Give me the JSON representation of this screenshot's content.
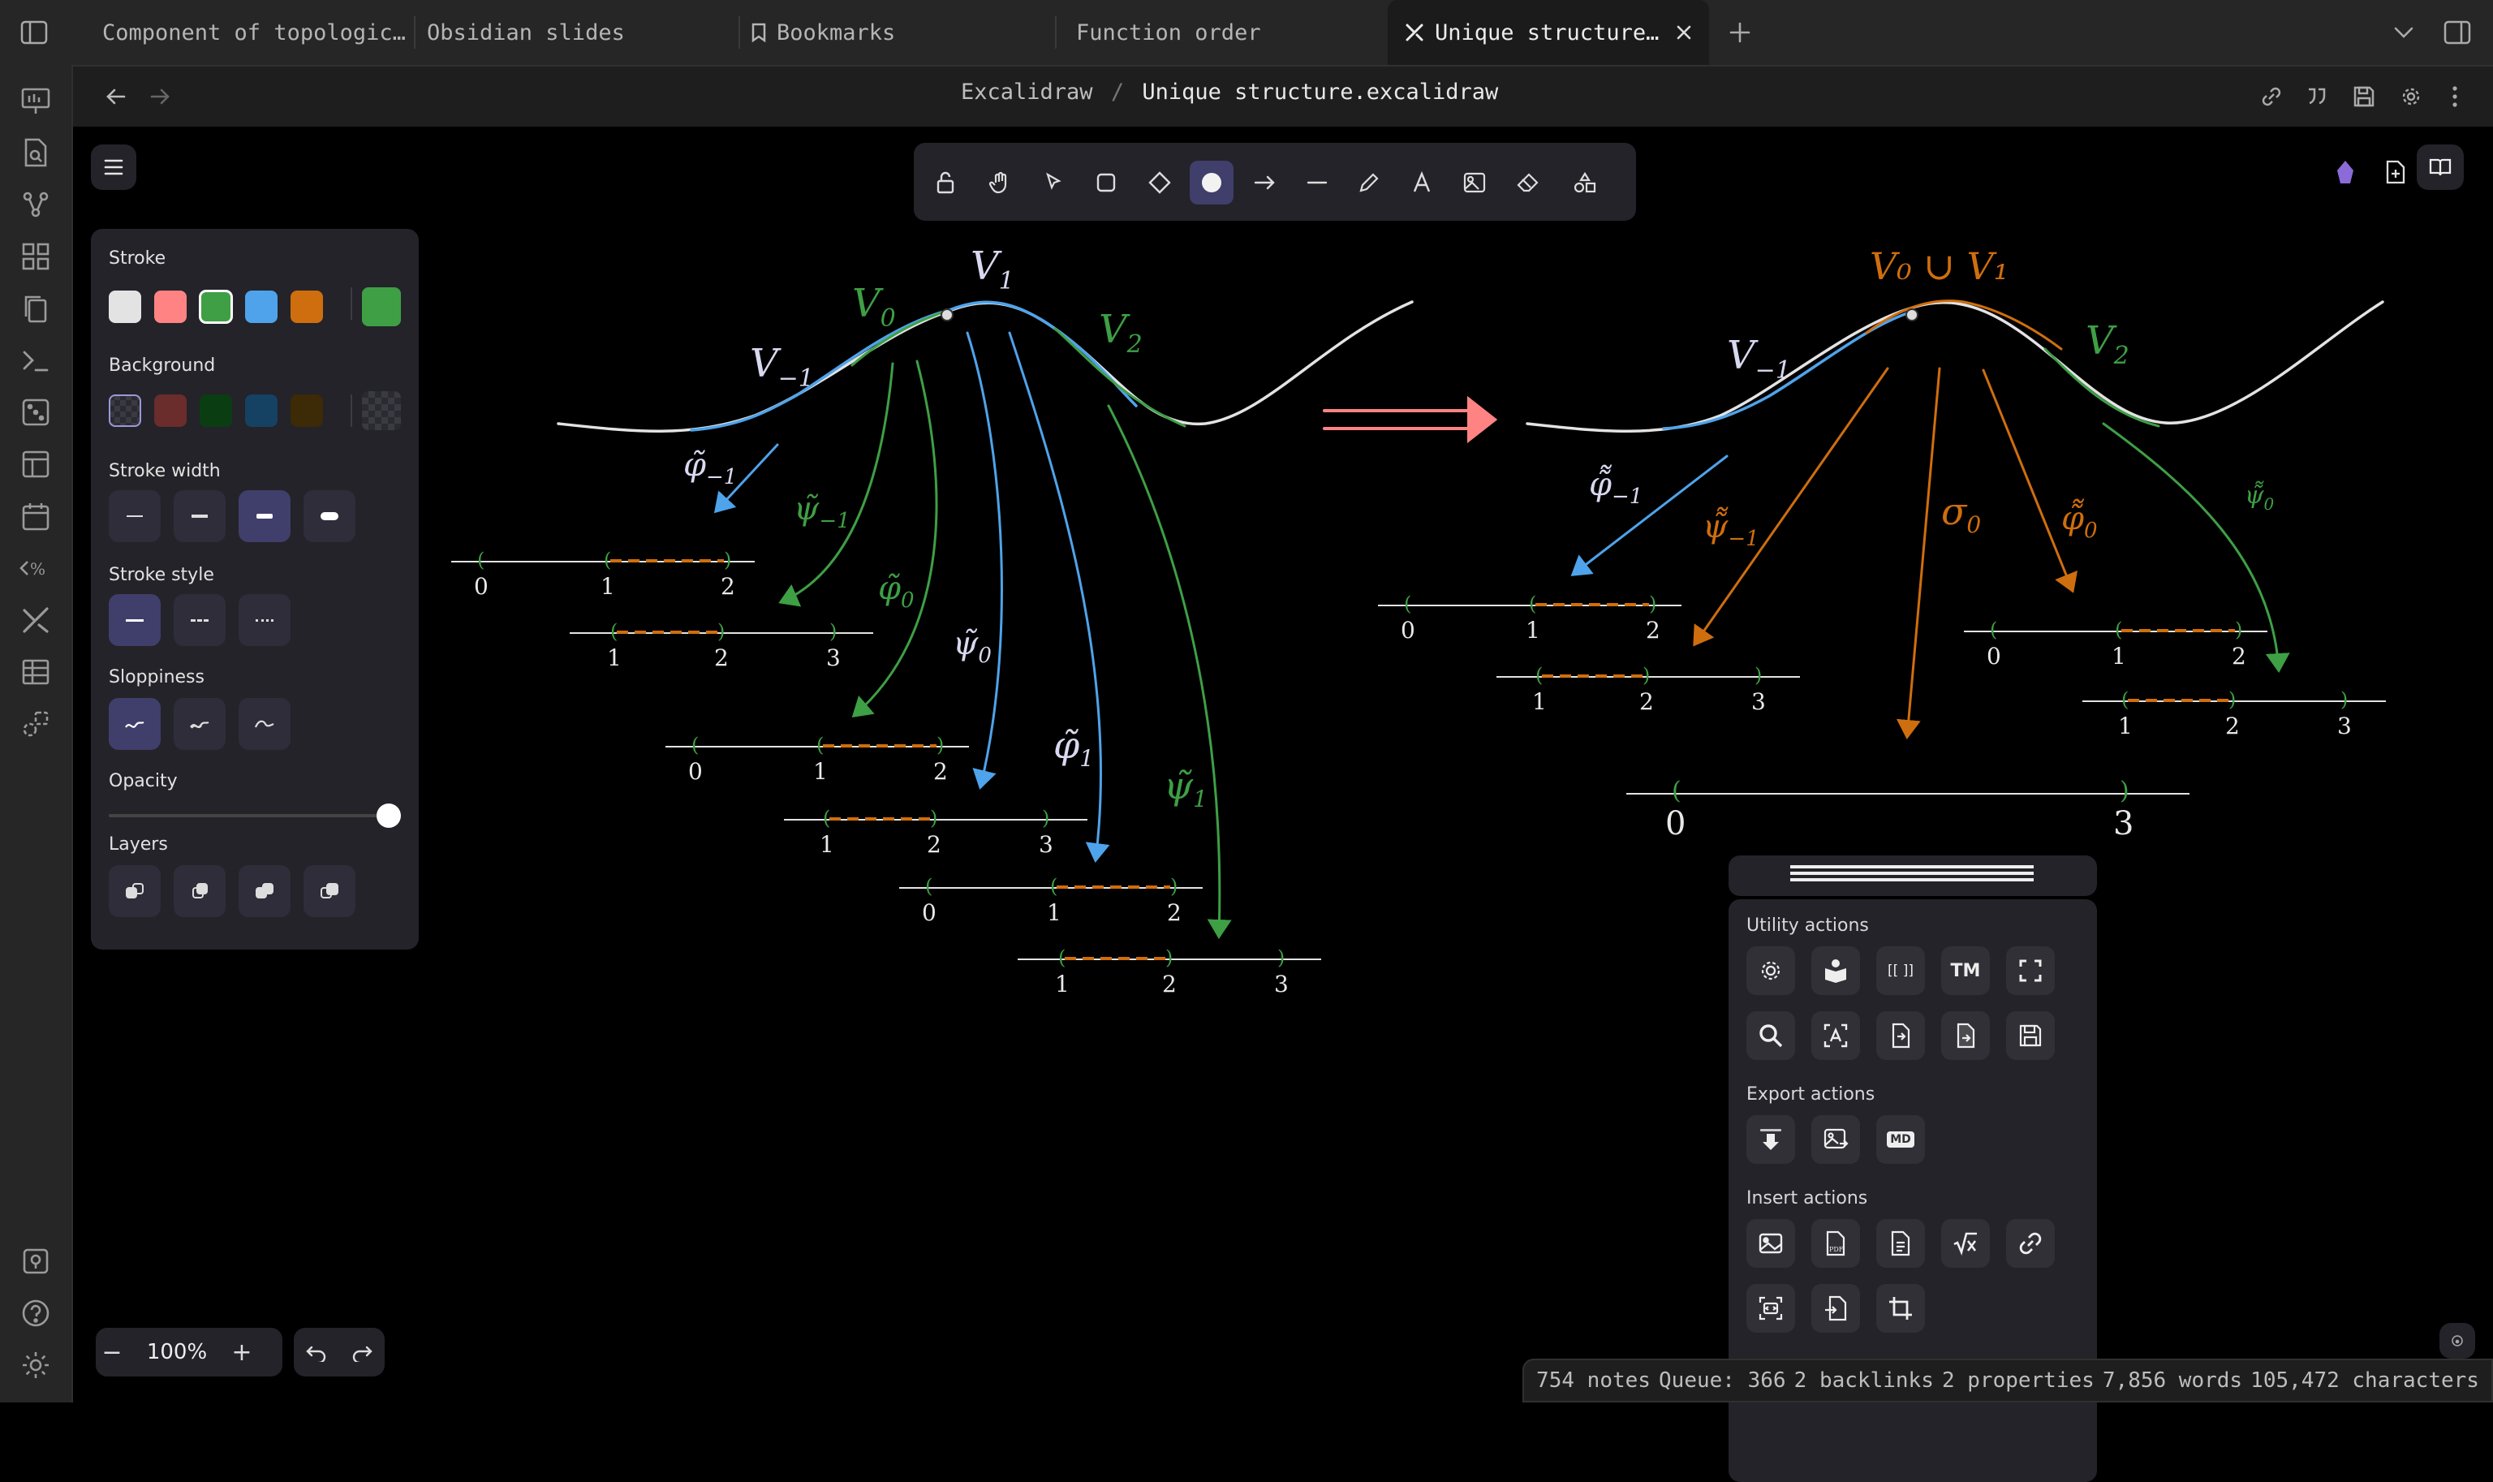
{
  "tabs": [
    {
      "label": "Component of topologic…",
      "active": false
    },
    {
      "label": "Obsidian slides",
      "active": false
    },
    {
      "label": "Bookmarks",
      "active": false
    },
    {
      "label": "Function order",
      "active": false
    },
    {
      "label": "Unique structure…",
      "active": true
    }
  ],
  "breadcrumb": {
    "folder": "Excalidraw",
    "separator": "/",
    "file": "Unique structure.excalidraw"
  },
  "props": {
    "stroke_label": "Stroke",
    "stroke_colors": [
      "#e3e3e3",
      "#ff8383",
      "#3e9f45",
      "#4fa3ea",
      "#cf6e0e"
    ],
    "stroke_current": "#3e9f45",
    "background_label": "Background",
    "background_colors": [
      "#2f2f36",
      "#6b2c2c",
      "#0b3d13",
      "#154163",
      "#3d2a06"
    ],
    "stroke_width_label": "Stroke width",
    "stroke_style_label": "Stroke style",
    "sloppiness_label": "Sloppiness",
    "opacity_label": "Opacity",
    "opacity_value": 100,
    "layers_label": "Layers"
  },
  "zoom": {
    "value": "100%",
    "minus": "−",
    "plus": "+"
  },
  "actions": {
    "utility_title": "Utility actions",
    "export_title": "Export actions",
    "insert_title": "Insert actions",
    "brackets_label": "[[ ]]",
    "tm_label": "TM",
    "md_label": "MD",
    "pdf_label": "PDF"
  },
  "status": {
    "notes": "754 notes",
    "queue": "Queue: 366",
    "backlinks": "2 backlinks",
    "properties": "2 properties",
    "words": "7,856 words",
    "characters": "105,472 characters"
  },
  "drawing": {
    "left": {
      "v_minus1": "V",
      "v_minus1_sub": "−1",
      "v0": "V",
      "v0_sub": "0",
      "v1": "V",
      "v1_sub": "1",
      "v2": "V",
      "v2_sub": "2",
      "phi_m1": "φ̃",
      "phi_m1_sub": "−1",
      "psi_m1": "ψ̃",
      "psi_m1_sub": "−1",
      "phi0": "φ̃",
      "phi0_sub": "0",
      "psi0": "ψ̃",
      "psi0_sub": "0",
      "phi1": "φ̃",
      "phi1_sub": "1",
      "psi1": "ψ̃",
      "psi1_sub": "1"
    },
    "right": {
      "union": "V₀ ∪ V₁",
      "v_minus1": "V",
      "v_minus1_sub": "−1",
      "v2": "V",
      "v2_sub": "2",
      "phi_m1": "φ̃̃",
      "phi_m1_sub": "−1",
      "psi_m1": "ψ̃̃",
      "psi_m1_sub": "−1",
      "sigma0": "σ",
      "sigma0_sub": "0",
      "phi0": "φ̃̃",
      "phi0_sub": "0",
      "psi0": "ψ̃̃",
      "psi0_sub": "0"
    },
    "ticks": {
      "t0": "0",
      "t1": "1",
      "t2": "2",
      "t3": "3"
    }
  },
  "colors": {
    "accent": "#403e6a",
    "green": "#3e9f45",
    "blue": "#4fa3ea",
    "orange": "#cf6e0e",
    "red": "#ff8383",
    "white": "#e3e3e3"
  }
}
